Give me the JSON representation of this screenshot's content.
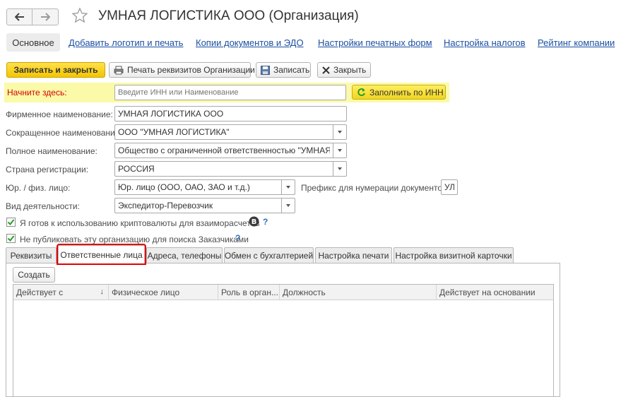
{
  "window": {
    "title": "УМНАЯ ЛОГИСТИКА ООО (Организация)"
  },
  "sections": {
    "active": "Основное",
    "links": [
      "Добавить логотип и печать",
      "Копии документов и ЭДО",
      "Настройки печатных форм",
      "Настройка налогов",
      "Рейтинг компании"
    ]
  },
  "toolbar": {
    "save_close": "Записать и закрыть",
    "print_requisites": "Печать реквизитов Организации",
    "save": "Записать",
    "close": "Закрыть"
  },
  "inn": {
    "label": "Начните здесь:",
    "placeholder": "Введите ИНН или Наименование",
    "fill_button": "Заполнить по ИНН"
  },
  "form": {
    "brand_name": {
      "label": "Фирменное наименование:",
      "value": "УМНАЯ ЛОГИСТИКА ООО"
    },
    "short_name": {
      "label": "Сокращенное наименование:",
      "value": "ООО \"УМНАЯ ЛОГИСТИКА\""
    },
    "full_name": {
      "label": "Полное наименование:",
      "value": "Общество с ограниченной ответственностью \"УМНАЯ ЛОГИ"
    },
    "country": {
      "label": "Страна регистрации:",
      "value": "РОССИЯ"
    },
    "entity_type": {
      "label": "Юр. / физ. лицо:",
      "value": "Юр. лицо (ООО, ОАО, ЗАО и т.д.)"
    },
    "doc_prefix": {
      "label": "Префикс для нумерации документов :",
      "value": "УЛ"
    },
    "activity": {
      "label": "Вид деятельности:",
      "value": "Экспедитор-Перевозчик"
    },
    "crypto": {
      "label": "Я готов к использованию криптовалюты для взаиморасчетов",
      "help": "?"
    },
    "no_publish": {
      "label": "Не публиковать эту организацию для поиска Заказчиками",
      "help": "?"
    }
  },
  "tabs": [
    "Реквизиты",
    "Ответственные лица",
    "Адреса, телефоны",
    "Обмен с бухгалтерией",
    "Настройка печати",
    "Настройка визитной карточки"
  ],
  "responsible": {
    "create_button": "Создать",
    "columns": [
      "Действует с",
      "Физическое лицо",
      "Роль в орган...",
      "Должность",
      "Действует на основании"
    ],
    "sort_indicator": "↓"
  },
  "colors": {
    "accent_yellow": "#f4c500",
    "highlight_strip": "#fafaa8",
    "link_blue": "#1c4fa2",
    "required_red": "#d40000",
    "tab_highlight": "#e20000"
  }
}
